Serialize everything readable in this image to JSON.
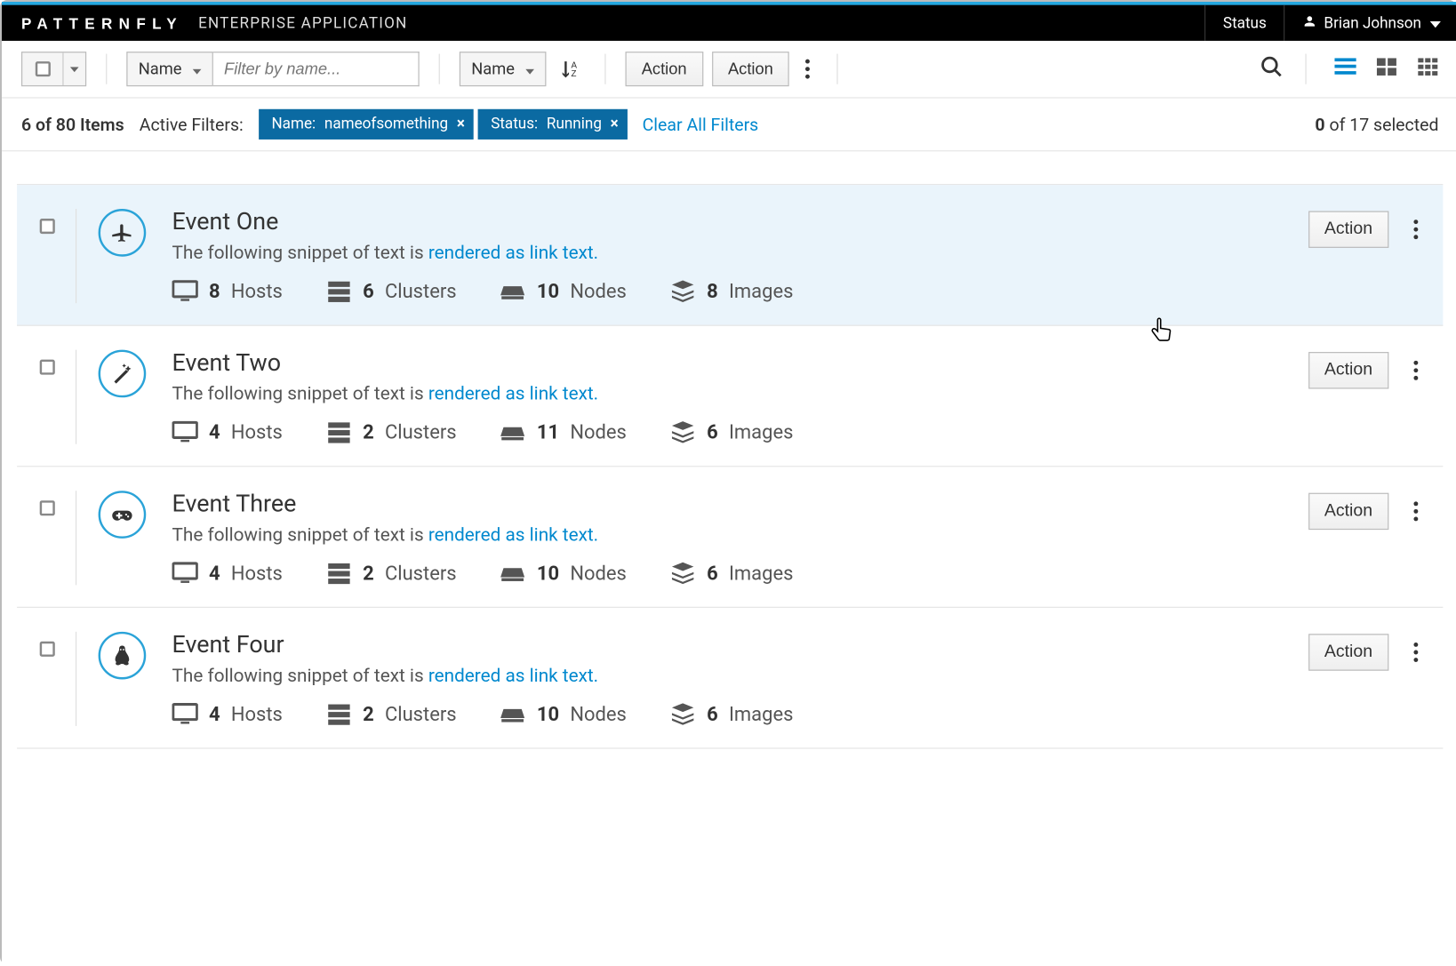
{
  "navbar": {
    "brand": "PATTERNFLY",
    "subtitle": "ENTERPRISE APPLICATION",
    "status_label": "Status",
    "user_name": "Brian Johnson"
  },
  "toolbar": {
    "filter_attr": "Name",
    "filter_placeholder": "Filter by name...",
    "sort_attr": "Name",
    "action1": "Action",
    "action2": "Action"
  },
  "filterbar": {
    "items_shown": "6",
    "items_total": "80",
    "items_suffix": "Items",
    "active_filters_label": "Active Filters:",
    "chips": [
      {
        "key": "Name:",
        "value": "nameofsomething"
      },
      {
        "key": "Status:",
        "value": "Running"
      }
    ],
    "clear_label": "Clear All Filters",
    "selected_count": "0",
    "selected_total": "17",
    "selected_suffix": "selected"
  },
  "row_common": {
    "desc_prefix": "The following snippet of text is ",
    "desc_link": "rendered as link text.",
    "hosts_label": "Hosts",
    "clusters_label": "Clusters",
    "nodes_label": "Nodes",
    "images_label": "Images",
    "action_label": "Action"
  },
  "rows": [
    {
      "title": "Event One",
      "icon": "plane",
      "hosts": "8",
      "clusters": "6",
      "nodes": "10",
      "images": "8",
      "hovered": true
    },
    {
      "title": "Event Two",
      "icon": "magic-wand",
      "hosts": "4",
      "clusters": "2",
      "nodes": "11",
      "images": "6",
      "hovered": false
    },
    {
      "title": "Event Three",
      "icon": "gamepad",
      "hosts": "4",
      "clusters": "2",
      "nodes": "10",
      "images": "6",
      "hovered": false
    },
    {
      "title": "Event Four",
      "icon": "linux",
      "hosts": "4",
      "clusters": "2",
      "nodes": "10",
      "images": "6",
      "hovered": false
    }
  ]
}
